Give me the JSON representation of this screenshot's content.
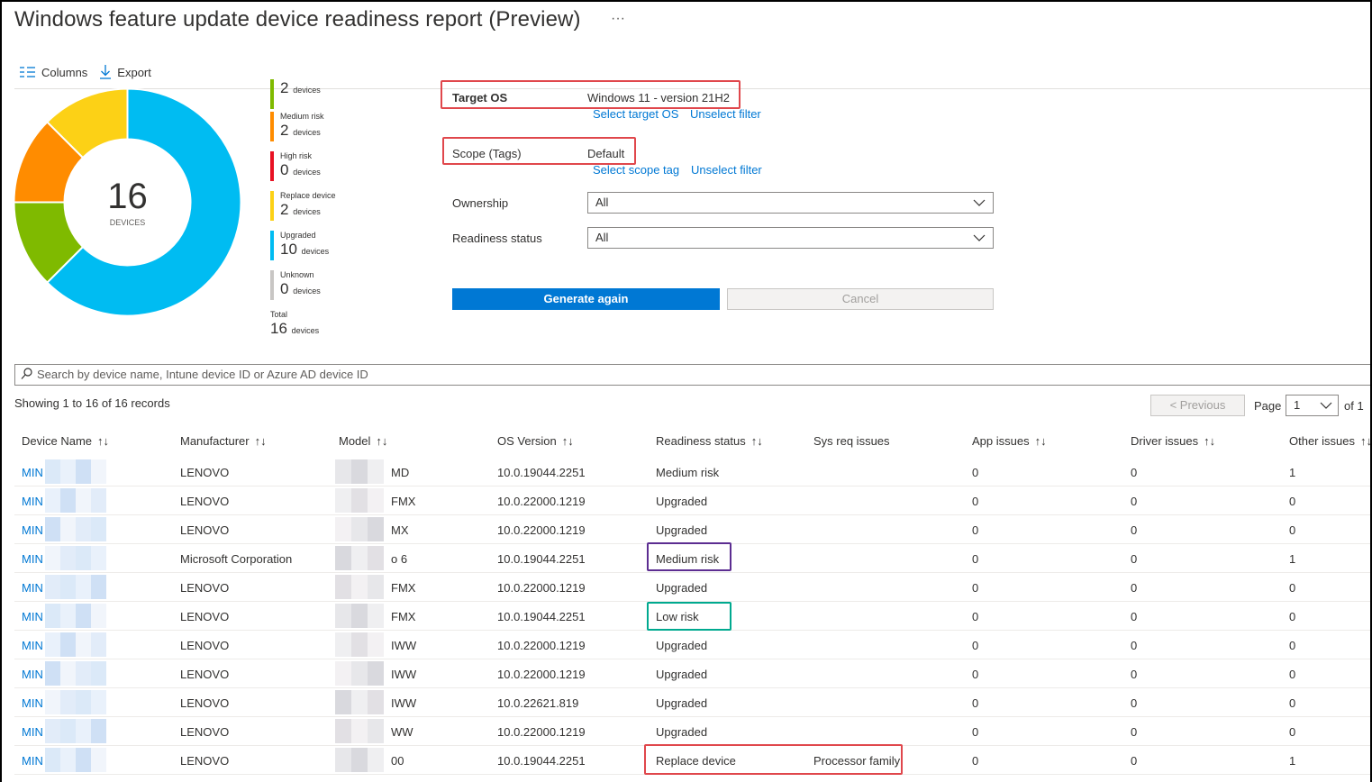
{
  "header": {
    "title": "Windows feature update device readiness report (Preview)",
    "more": "···"
  },
  "toolbar": {
    "columns_label": "Columns",
    "export_label": "Export"
  },
  "summary": {
    "total_number": "16",
    "total_caption": "DEVICES",
    "legend": [
      {
        "name": "",
        "value": "2",
        "unit": "devices",
        "color": "#7fba00"
      },
      {
        "name": "Medium risk",
        "value": "2",
        "unit": "devices",
        "color": "#ff8c00"
      },
      {
        "name": "High risk",
        "value": "0",
        "unit": "devices",
        "color": "#e81123"
      },
      {
        "name": "Replace device",
        "value": "2",
        "unit": "devices",
        "color": "#fcd116"
      },
      {
        "name": "Upgraded",
        "value": "10",
        "unit": "devices",
        "color": "#00bcf2"
      },
      {
        "name": "Unknown",
        "value": "0",
        "unit": "devices",
        "color": "#c8c6c4"
      }
    ],
    "total": {
      "name": "Total",
      "value": "16",
      "unit": "devices"
    },
    "donut_segments": [
      {
        "label": "Upgraded",
        "value": 10,
        "color": "#00bcf2"
      },
      {
        "label": "Low risk",
        "value": 2,
        "color": "#7fba00"
      },
      {
        "label": "Medium risk",
        "value": 2,
        "color": "#ff8c00"
      },
      {
        "label": "Replace device",
        "value": 2,
        "color": "#fcd116"
      }
    ]
  },
  "filters": {
    "target_os_label": "Target OS",
    "target_os_value": "Windows 11 - version 21H2",
    "select_target_os": "Select target OS",
    "unselect_filter_1": "Unselect filter",
    "scope_label": "Scope (Tags)",
    "scope_value": "Default",
    "select_scope_tag": "Select scope tag",
    "unselect_filter_2": "Unselect filter",
    "ownership_label": "Ownership",
    "ownership_value": "All",
    "readiness_label": "Readiness status",
    "readiness_value": "All",
    "generate_label": "Generate again",
    "cancel_label": "Cancel"
  },
  "search": {
    "placeholder": "Search by device name, Intune device ID or Azure AD device ID"
  },
  "pager": {
    "showing": "Showing 1 to 16 of 16 records",
    "previous": "< Previous",
    "page_label": "Page",
    "page_value": "1",
    "of_label": "of 1"
  },
  "table": {
    "headers": [
      "Device Name",
      "Manufacturer",
      "Model",
      "OS Version",
      "Readiness status",
      "Sys req issues",
      "App issues",
      "Driver issues",
      "Other issues"
    ],
    "sort_icon": "↑↓",
    "rows": [
      {
        "name": "MIN",
        "manufacturer": "LENOVO",
        "model": "MD",
        "os": "10.0.19044.2251",
        "status": "Medium risk",
        "sysreq": "",
        "app": "0",
        "driver": "0",
        "other": "1"
      },
      {
        "name": "MIN",
        "manufacturer": "LENOVO",
        "model": "FMX",
        "os": "10.0.22000.1219",
        "status": "Upgraded",
        "sysreq": "",
        "app": "0",
        "driver": "0",
        "other": "0"
      },
      {
        "name": "MIN",
        "manufacturer": "LENOVO",
        "model": "MX",
        "os": "10.0.22000.1219",
        "status": "Upgraded",
        "sysreq": "",
        "app": "0",
        "driver": "0",
        "other": "0"
      },
      {
        "name": "MIN",
        "manufacturer": "Microsoft Corporation",
        "model": "o 6",
        "os": "10.0.19044.2251",
        "status": "Medium risk",
        "sysreq": "",
        "app": "0",
        "driver": "0",
        "other": "1"
      },
      {
        "name": "MIN",
        "manufacturer": "LENOVO",
        "model": "FMX",
        "os": "10.0.22000.1219",
        "status": "Upgraded",
        "sysreq": "",
        "app": "0",
        "driver": "0",
        "other": "0"
      },
      {
        "name": "MIN",
        "manufacturer": "LENOVO",
        "model": "FMX",
        "os": "10.0.19044.2251",
        "status": "Low risk",
        "sysreq": "",
        "app": "0",
        "driver": "0",
        "other": "0"
      },
      {
        "name": "MIN",
        "manufacturer": "LENOVO",
        "model": "IWW",
        "os": "10.0.22000.1219",
        "status": "Upgraded",
        "sysreq": "",
        "app": "0",
        "driver": "0",
        "other": "0"
      },
      {
        "name": "MIN",
        "manufacturer": "LENOVO",
        "model": "IWW",
        "os": "10.0.22000.1219",
        "status": "Upgraded",
        "sysreq": "",
        "app": "0",
        "driver": "0",
        "other": "0"
      },
      {
        "name": "MIN",
        "manufacturer": "LENOVO",
        "model": "IWW",
        "os": "10.0.22621.819",
        "status": "Upgraded",
        "sysreq": "",
        "app": "0",
        "driver": "0",
        "other": "0"
      },
      {
        "name": "MIN",
        "manufacturer": "LENOVO",
        "model": "WW",
        "os": "10.0.22000.1219",
        "status": "Upgraded",
        "sysreq": "",
        "app": "0",
        "driver": "0",
        "other": "0"
      },
      {
        "name": "MIN",
        "manufacturer": "LENOVO",
        "model": "00",
        "os": "10.0.19044.2251",
        "status": "Replace device",
        "sysreq": "Processor family",
        "app": "0",
        "driver": "0",
        "other": "1"
      }
    ]
  },
  "colors": {
    "accent": "#0078d4",
    "highlight_red": "#e0474c",
    "highlight_purple": "#5c2d91",
    "highlight_teal": "#00a98f"
  }
}
